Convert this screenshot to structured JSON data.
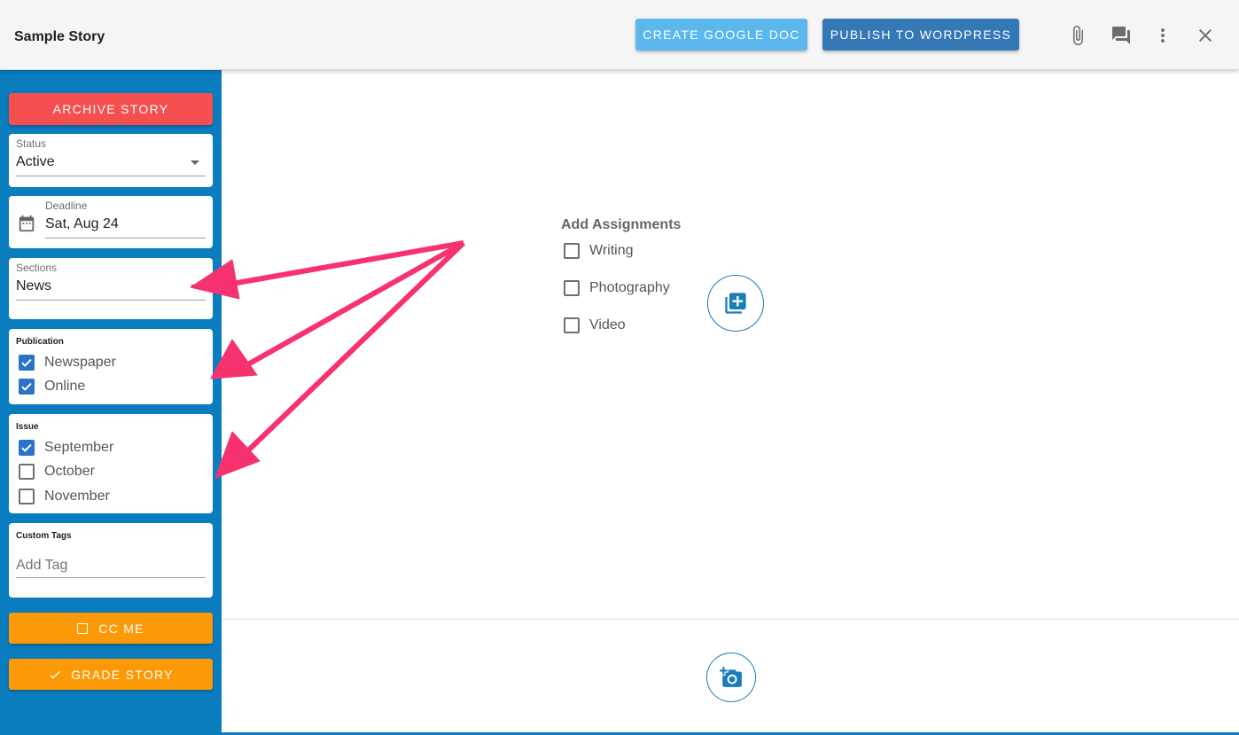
{
  "header": {
    "title": "Sample Story",
    "create_gdoc_label": "CREATE GOOGLE DOC",
    "publish_wp_label": "PUBLISH TO WORDPRESS",
    "icons": [
      "paperclip-icon",
      "comments-icon",
      "more-vert-icon",
      "close-icon"
    ]
  },
  "sidebar": {
    "archive_label": "ARCHIVE STORY",
    "status": {
      "label": "Status",
      "value": "Active"
    },
    "deadline": {
      "label": "Deadline",
      "value": "Sat, Aug 24"
    },
    "sections": {
      "label": "Sections",
      "value": "News"
    },
    "publication": {
      "label": "Publication",
      "options": [
        {
          "label": "Newspaper",
          "checked": true
        },
        {
          "label": "Online",
          "checked": true
        }
      ]
    },
    "issue": {
      "label": "Issue",
      "options": [
        {
          "label": "September",
          "checked": true
        },
        {
          "label": "October",
          "checked": false
        },
        {
          "label": "November",
          "checked": false
        }
      ]
    },
    "custom_tags": {
      "label": "Custom Tags",
      "placeholder": "Add Tag"
    },
    "cc_me_label": "CC ME",
    "grade_label": "GRADE STORY"
  },
  "main": {
    "assignments_title": "Add Assignments",
    "assignments": [
      {
        "label": "Writing",
        "checked": false
      },
      {
        "label": "Photography",
        "checked": false
      },
      {
        "label": "Video",
        "checked": false
      }
    ]
  },
  "colors": {
    "sidebar": "#0a7dbf",
    "archive": "#f5504f",
    "orange": "#fb9a06",
    "gdoc": "#5bb7ee",
    "wordpress": "#3478b6",
    "checkbox": "#2a73c9",
    "annotation_arrow": "#f7336f"
  }
}
